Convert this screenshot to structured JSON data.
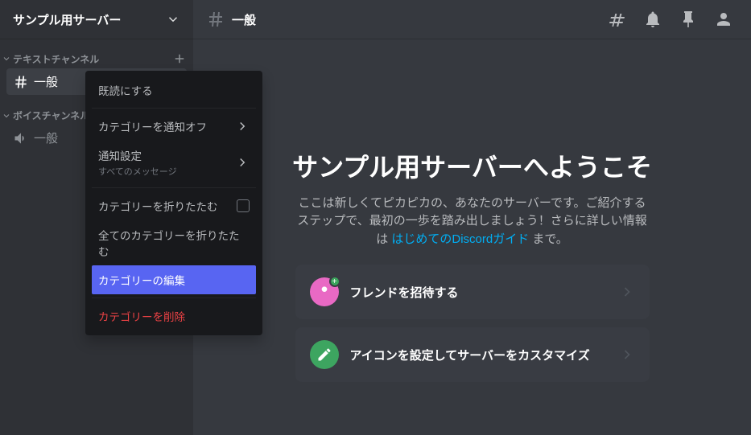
{
  "server": {
    "name": "サンプル用サーバー"
  },
  "categories": {
    "text": {
      "label": "テキストチャンネル"
    },
    "voice": {
      "label": "ボイスチャンネル"
    }
  },
  "channels": {
    "text_general": "一般",
    "voice_general": "一般"
  },
  "topbar": {
    "channel": "一般"
  },
  "context_menu": {
    "mark_read": "既読にする",
    "mute_category": "カテゴリーを通知オフ",
    "notification_settings": "通知設定",
    "notification_sub": "すべてのメッセージ",
    "collapse_category": "カテゴリーを折りたたむ",
    "collapse_all": "全てのカテゴリーを折りたたむ",
    "edit_category": "カテゴリーの編集",
    "delete_category": "カテゴリーを削除"
  },
  "welcome": {
    "title": "サンプル用サーバーへようこそ",
    "description_before": "ここは新しくてピカピカの、あなたのサーバーです。ご紹介するステップで、最初の一歩を踏み出しましょう！さらに詳しい情報は ",
    "description_link": "はじめてのDiscordガイド",
    "description_after": " まで。"
  },
  "cards": {
    "invite": "フレンドを招待する",
    "customize": "アイコンを設定してサーバーをカスタマイズ"
  }
}
